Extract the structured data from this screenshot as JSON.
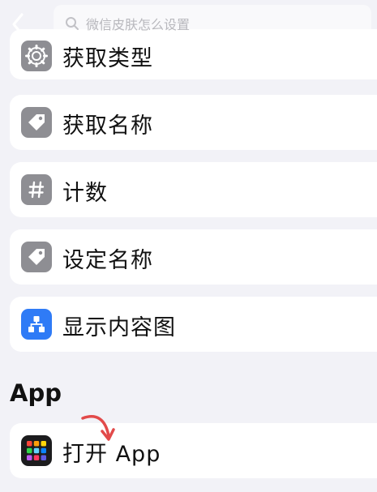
{
  "search": {
    "placeholder": "微信皮肤怎么设置"
  },
  "actions": [
    {
      "label": "获取类型",
      "icon": "gear-icon",
      "color": "#8e8e93"
    },
    {
      "label": "获取名称",
      "icon": "tag-icon",
      "color": "#8e8e93"
    },
    {
      "label": "计数",
      "icon": "hash-icon",
      "color": "#8e8e93"
    },
    {
      "label": "设定名称",
      "icon": "tag-icon",
      "color": "#8e8e93"
    },
    {
      "label": "显示内容图",
      "icon": "hierarchy-icon",
      "color": "#2f7bf6"
    }
  ],
  "app_section": {
    "heading": "App",
    "items": [
      {
        "label": "打开 App",
        "icon": "app-grid-icon"
      }
    ]
  },
  "colors": {
    "background": "#f2f2f7",
    "card": "#ffffff",
    "gray_icon": "#8e8e93",
    "blue_icon": "#2f7bf6",
    "annotation_arrow": "#e24a4a"
  }
}
